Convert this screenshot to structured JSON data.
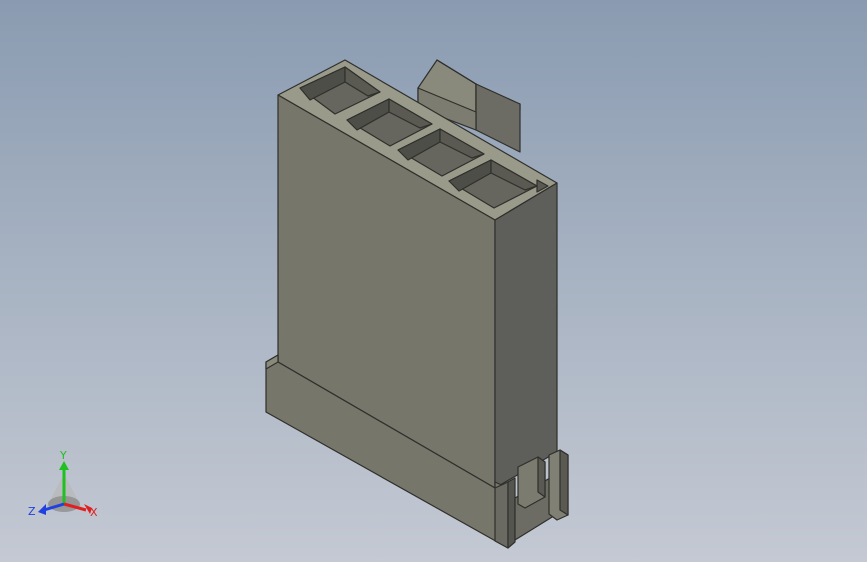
{
  "viewport": {
    "background_top": "#8a9bb1",
    "background_bottom": "#c4c9d3"
  },
  "model": {
    "description_icon": "connector-housing-model",
    "slot_count": 4,
    "colors": {
      "front_face": "#76766a",
      "side_face": "#5e5e5a",
      "top_face": "#9a9a8a",
      "edge": "#2f2f2c",
      "slot_dark": "#50504a"
    }
  },
  "triad": {
    "x_label": "X",
    "y_label": "Y",
    "z_label": "Z",
    "x_color": "#e02020",
    "y_color": "#20c020",
    "z_color": "#2040e0"
  }
}
